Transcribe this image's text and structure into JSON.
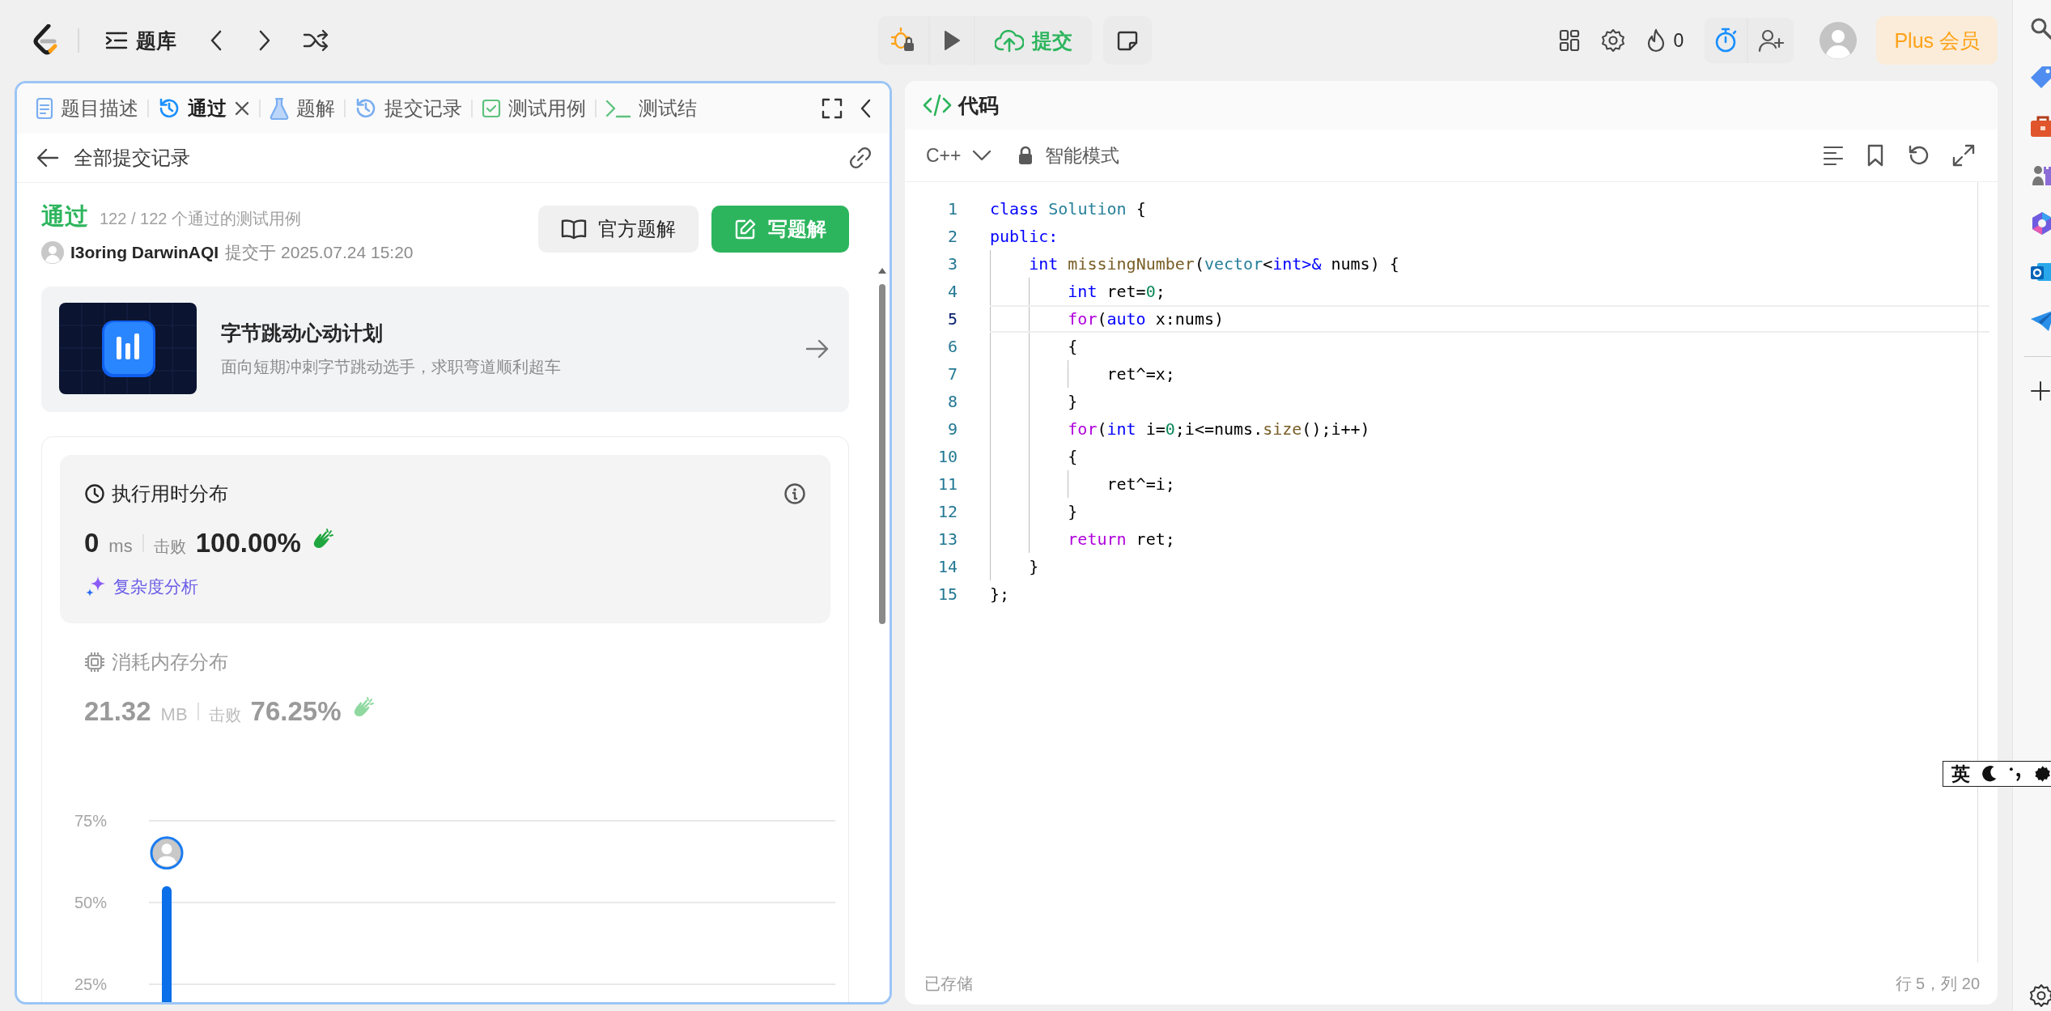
{
  "top_bar": {
    "nav_label": "题库",
    "submit_label": "提交",
    "streak": "0",
    "timer_active": true,
    "plus_label": "Plus 会员"
  },
  "left_panel": {
    "tabs": [
      {
        "label": "题目描述",
        "kind": "description",
        "selected": false,
        "closable": false
      },
      {
        "label": "通过",
        "kind": "history",
        "selected": true,
        "closable": true
      },
      {
        "label": "题解",
        "kind": "flask",
        "selected": false,
        "closable": false
      },
      {
        "label": "提交记录",
        "kind": "history",
        "selected": false,
        "closable": false
      },
      {
        "label": "测试用例",
        "kind": "checkbox",
        "selected": false,
        "closable": false
      },
      {
        "label": "测试结",
        "kind": "terminal",
        "selected": false,
        "closable": false
      }
    ],
    "back_label": "全部提交记录",
    "result": {
      "status": "通过",
      "cases": "122 / 122 个通过的测试用例",
      "user": "I3oring DarwinAQI",
      "submitted": "提交于 2025.07.24 15:20"
    },
    "buttons": [
      {
        "label": "官方题解",
        "kind": "secondary"
      },
      {
        "label": "写题解",
        "kind": "primary"
      }
    ],
    "promo": {
      "title": "字节跳动心动计划",
      "subtitle": "面向短期冲刺字节跳动选手，求职弯道顺利超车"
    },
    "stats": [
      {
        "kind": "runtime",
        "title": "执行用时分布",
        "value": "0",
        "unit": "ms",
        "beats_label": "击败",
        "beats": "100.00%",
        "analysis": "复杂度分析",
        "active": true
      },
      {
        "kind": "memory",
        "title": "消耗内存分布",
        "value": "21.32",
        "unit": "MB",
        "beats_label": "击败",
        "beats": "76.25%",
        "active": false
      }
    ],
    "chart_data": {
      "type": "bar",
      "ylim": [
        0,
        75
      ],
      "yticks": [
        {
          "value": 25,
          "label": "25%"
        },
        {
          "value": 50,
          "label": "50%"
        },
        {
          "value": 75,
          "label": "75%"
        }
      ],
      "values": [
        55
      ]
    }
  },
  "editor": {
    "title": "代码",
    "language": "C++",
    "mode": "智能模式",
    "lines": [
      {
        "number": "1",
        "selected": false,
        "tokens": [
          {
            "text": "class",
            "kind": "keyword"
          },
          {
            "text": " Solution",
            "kind": "type"
          },
          {
            "text": " {",
            "kind": "plain"
          }
        ]
      },
      {
        "number": "2",
        "selected": false,
        "tokens": [
          {
            "text": "public:",
            "kind": "keyword"
          }
        ]
      },
      {
        "number": "3",
        "selected": false,
        "tokens": [
          {
            "text": "    int",
            "kind": "keyword"
          },
          {
            "text": " missingNumber",
            "kind": "function"
          },
          {
            "text": "(",
            "kind": "plain"
          },
          {
            "text": "vector",
            "kind": "type"
          },
          {
            "text": "<",
            "kind": "plain"
          },
          {
            "text": "int>&",
            "kind": "keyword"
          },
          {
            "text": " nums) {",
            "kind": "plain"
          }
        ]
      },
      {
        "number": "4",
        "selected": false,
        "tokens": [
          {
            "text": "        int",
            "kind": "keyword"
          },
          {
            "text": " ret=",
            "kind": "plain"
          },
          {
            "text": "0",
            "kind": "number"
          },
          {
            "text": ";",
            "kind": "plain"
          }
        ]
      },
      {
        "number": "5",
        "selected": true,
        "tokens": [
          {
            "text": "        for",
            "kind": "control"
          },
          {
            "text": "(",
            "kind": "plain"
          },
          {
            "text": "auto",
            "kind": "keyword"
          },
          {
            "text": " x:nums)",
            "kind": "plain"
          }
        ]
      },
      {
        "number": "6",
        "selected": false,
        "tokens": [
          {
            "text": "        {",
            "kind": "plain"
          }
        ]
      },
      {
        "number": "7",
        "selected": false,
        "tokens": [
          {
            "text": "            ret^=x;",
            "kind": "plain"
          }
        ]
      },
      {
        "number": "8",
        "selected": false,
        "tokens": [
          {
            "text": "        }",
            "kind": "plain"
          }
        ]
      },
      {
        "number": "9",
        "selected": false,
        "tokens": [
          {
            "text": "        for",
            "kind": "control"
          },
          {
            "text": "(",
            "kind": "plain"
          },
          {
            "text": "int",
            "kind": "keyword"
          },
          {
            "text": " i=",
            "kind": "plain"
          },
          {
            "text": "0",
            "kind": "number"
          },
          {
            "text": ";i<=nums.",
            "kind": "plain"
          },
          {
            "text": "size",
            "kind": "function"
          },
          {
            "text": "();i++)",
            "kind": "plain"
          }
        ]
      },
      {
        "number": "10",
        "selected": false,
        "tokens": [
          {
            "text": "        {",
            "kind": "plain"
          }
        ]
      },
      {
        "number": "11",
        "selected": false,
        "tokens": [
          {
            "text": "            ret^=i;",
            "kind": "plain"
          }
        ]
      },
      {
        "number": "12",
        "selected": false,
        "tokens": [
          {
            "text": "        }",
            "kind": "plain"
          }
        ]
      },
      {
        "number": "13",
        "selected": false,
        "tokens": [
          {
            "text": "        return",
            "kind": "control"
          },
          {
            "text": " ret;",
            "kind": "plain"
          }
        ]
      },
      {
        "number": "14",
        "selected": false,
        "tokens": [
          {
            "text": "    }",
            "kind": "plain"
          }
        ]
      },
      {
        "number": "15",
        "selected": false,
        "tokens": [
          {
            "text": "};",
            "kind": "plain"
          }
        ]
      }
    ],
    "saved": "已存储",
    "cursor": "行 5，列 20"
  },
  "ime": {
    "label": "英"
  }
}
